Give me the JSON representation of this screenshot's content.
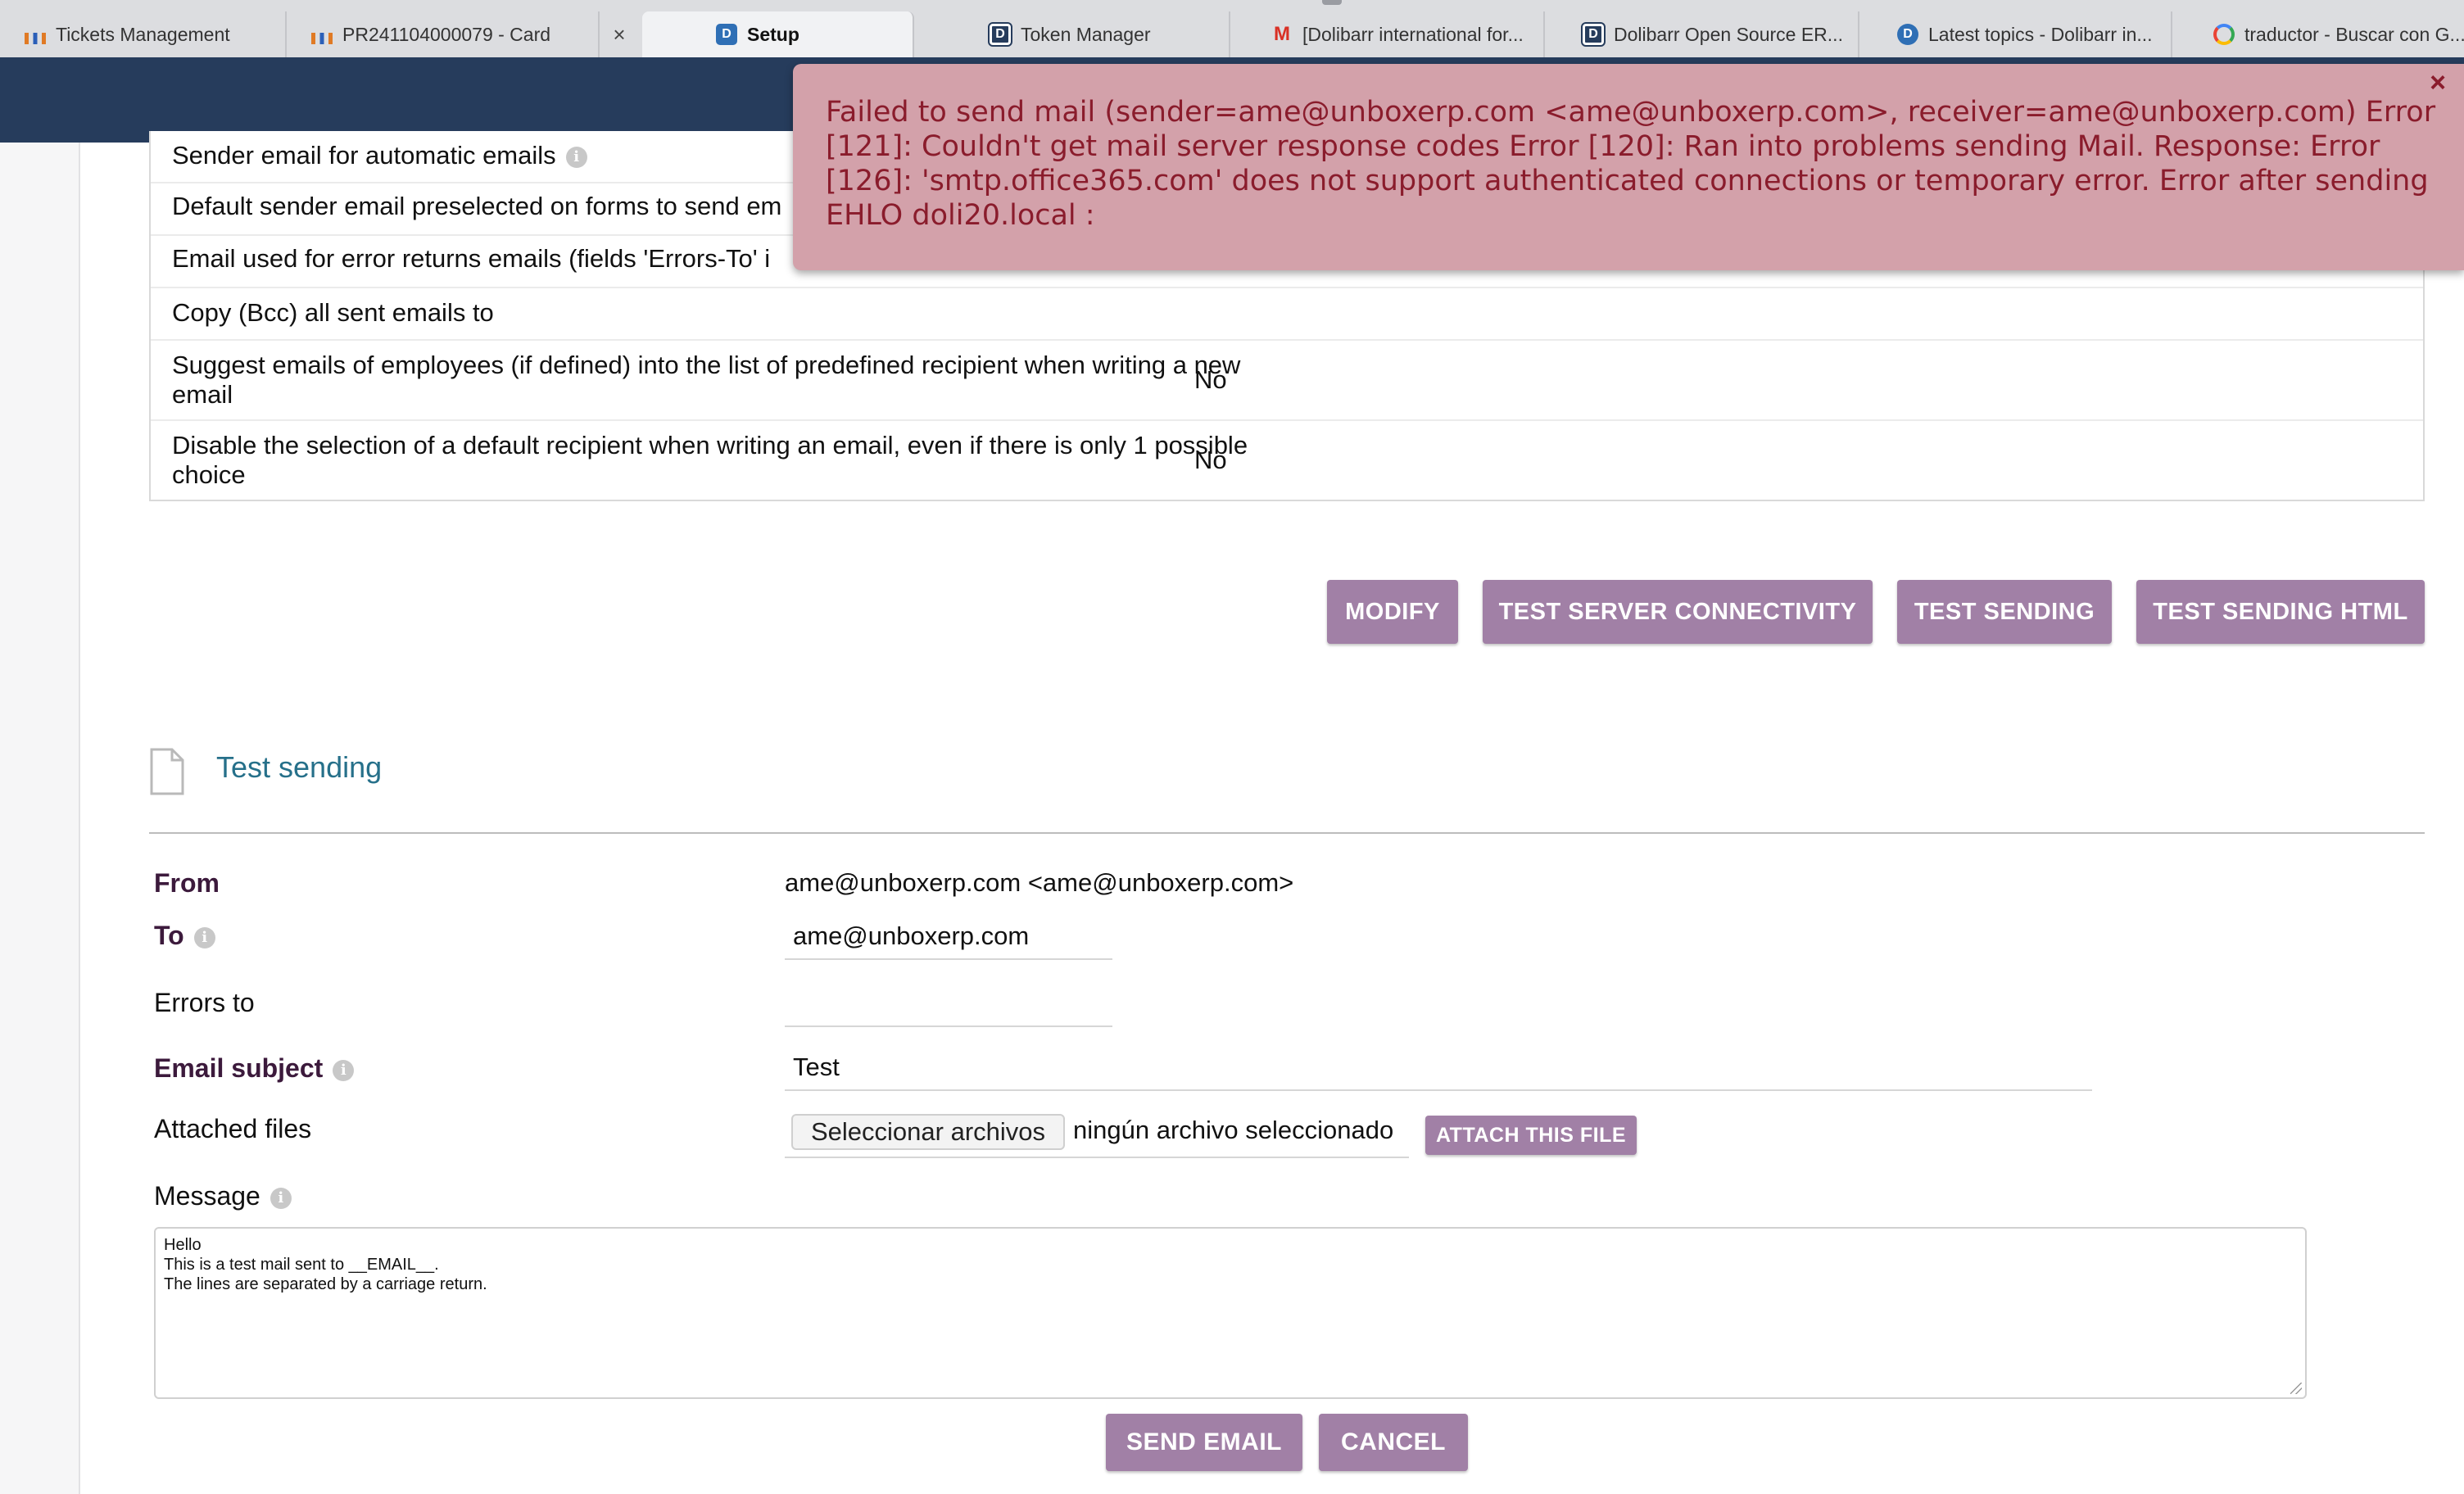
{
  "browser": {
    "tabs": [
      {
        "label": "Tickets Management",
        "icon": "dolibarr-bars-icon"
      },
      {
        "label": "PR241104000079 - Card",
        "icon": "dolibarr-bars-icon"
      },
      {
        "label": "Setup",
        "icon": "dolibarr-d-icon",
        "active": true
      },
      {
        "label": "Token Manager",
        "icon": "dolibarr-d-icon"
      },
      {
        "label": "[Dolibarr international for...",
        "icon": "gmail-icon"
      },
      {
        "label": "Dolibarr Open Source ER...",
        "icon": "dolibarr-d-icon"
      },
      {
        "label": "Latest topics - Dolibarr in...",
        "icon": "dolibarr-forum-icon"
      },
      {
        "label": "traductor - Buscar con G...",
        "icon": "google-icon"
      }
    ],
    "close_glyph": "×"
  },
  "error_popup": {
    "message": "Failed to send mail (sender=ame@unboxerp.com <ame@unboxerp.com>, receiver=ame@unboxerp.com) Error [121]: Couldn't get mail server response codes Error [120]: Ran into problems sending Mail. Response: Error [126]: 'smtp.office365.com' does not support authenticated connections or temporary error. Error after sending EHLO doli20.local :",
    "close_glyph": "×",
    "text_color": "#8a1c2c",
    "background": "#d3a1aa"
  },
  "settings_rows": [
    {
      "label": "Sender email for automatic emails",
      "value": ""
    },
    {
      "label": "Default sender email preselected on forms to send em",
      "value": ""
    },
    {
      "label": "Email used for error returns emails (fields 'Errors-To' i",
      "value": ""
    },
    {
      "label": "Copy (Bcc) all sent emails to",
      "value": ""
    },
    {
      "label": "Suggest emails of employees (if defined) into the list of predefined recipient when writing a new email",
      "value": "No"
    },
    {
      "label": "Disable the selection of a default recipient when writing an email, even if there is only 1 possible choice",
      "value": "No"
    }
  ],
  "actions": {
    "modify": "MODIFY",
    "test_connectivity": "TEST SERVER CONNECTIVITY",
    "test_sending": "TEST SENDING",
    "test_sending_html": "TEST SENDING HTML"
  },
  "test_section": {
    "title": "Test sending",
    "from_label": "From",
    "from_value": "ame@unboxerp.com <ame@unboxerp.com>",
    "to_label": "To",
    "to_value": "ame@unboxerp.com",
    "errors_to_label": "Errors to",
    "errors_to_value": "",
    "subject_label": "Email subject",
    "subject_value": "Test",
    "attached_label": "Attached files",
    "choose_files": "Seleccionar archivos",
    "no_file": "ningún archivo seleccionado",
    "attach_button": "ATTACH THIS FILE",
    "message_label": "Message",
    "message_value": "Hello\nThis is a test mail sent to __EMAIL__.\nThe lines are separated by a carriage return.",
    "send_button": "SEND EMAIL",
    "cancel_button": "CANCEL"
  },
  "colors": {
    "header": "#263c5c",
    "button": "#a180a6",
    "section_title": "#26708a"
  }
}
